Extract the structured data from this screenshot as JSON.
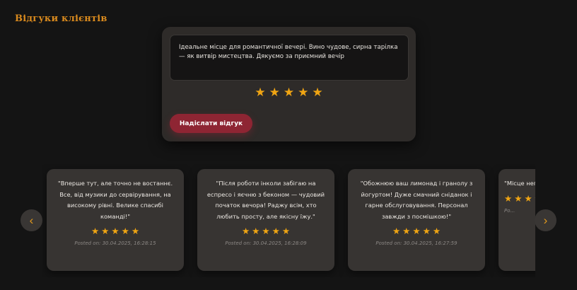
{
  "section": {
    "title": "Відгуки клієнтів"
  },
  "form": {
    "review_text": "Ідеальне місце для романтичної вечері. Вино чудове, сирна тарілка — як витвір мистецтва. Дякуємо за приємний вечір",
    "rating": 5,
    "max_rating": 5,
    "submit_label": "Надіслати відгук"
  },
  "carousel": {
    "prev_icon": "‹",
    "next_icon": "›",
    "reviews": [
      {
        "text": "\"Вперше тут, але точно не востаннє. Все, від музики до сервірування, на високому рівні. Велике спасибі команді!\"",
        "rating": 5,
        "date": "Posted on: 30.04.2025, 16:28:15"
      },
      {
        "text": "\"Після роботи інколи забігаю на еспресо і яєчню з беконом — чудовий початок вечора! Раджу всім, хто любить просту, але якісну їжу.\"",
        "rating": 5,
        "date": "Posted on: 30.04.2025, 16:28:09"
      },
      {
        "text": "\"Обожнюю ваш лимонад і гранолу з йогуртом! Дуже смачний сніданок і гарне обслуговування. Персонал завжди з посмішкою!\"",
        "rating": 5,
        "date": "Posted on: 30.04.2025, 16:27:59"
      },
      {
        "text": "\"Місце неп... день. Стра... медом, ал...",
        "rating": 5,
        "date": "Po..."
      }
    ]
  },
  "colors": {
    "accent": "#f0a513",
    "title": "#d98a1e",
    "button": "#8e2533",
    "background": "#141414",
    "card": "#373432"
  }
}
